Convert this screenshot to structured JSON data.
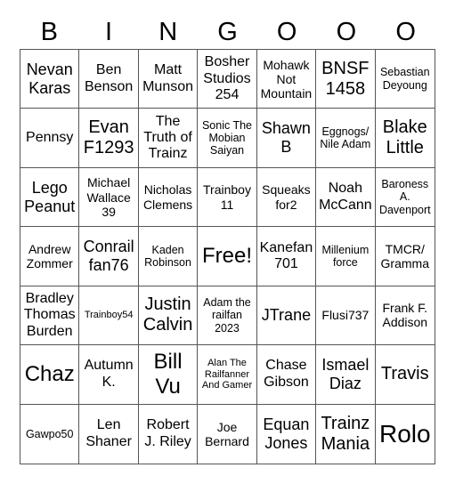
{
  "header": [
    "B",
    "I",
    "N",
    "G",
    "O",
    "O",
    "O"
  ],
  "cells": [
    [
      "Nevan Karas",
      "Ben Benson",
      "Matt Munson",
      "Bosher Studios 254",
      "Mohawk Not Mountain",
      "BNSF 1458",
      "Sebastian Deyoung"
    ],
    [
      "Pennsy",
      "Evan F1293",
      "The Truth of Trainz",
      "Sonic The Mobian Saiyan",
      "Shawn B",
      "Eggnogs/ Nile Adam",
      "Blake Little"
    ],
    [
      "Lego Peanut",
      "Michael Wallace 39",
      "Nicholas Clemens",
      "Trainboy 11",
      "Squeaks for2",
      "Noah McCann",
      "Baroness A. Davenport"
    ],
    [
      "Andrew Zommer",
      "Conrail fan76",
      "Kaden Robinson",
      "Free!",
      "Kanefan 701",
      "Millenium force",
      "TMCR/ Gramma"
    ],
    [
      "Bradley Thomas Burden",
      "Trainboy54",
      "Justin Calvin",
      "Adam the railfan 2023",
      "JTrane",
      "Flusi737",
      "Frank F. Addison"
    ],
    [
      "Chaz",
      "Autumn K.",
      "Bill Vu",
      "Alan The Railfanner And Gamer",
      "Chase Gibson",
      "Ismael Diaz",
      "Travis"
    ],
    [
      "Gawpo50",
      "Len Shaner",
      "Robert J. Riley",
      "Joe Bernard",
      "Equan Jones",
      "Trainz Mania",
      "Rolo"
    ]
  ]
}
